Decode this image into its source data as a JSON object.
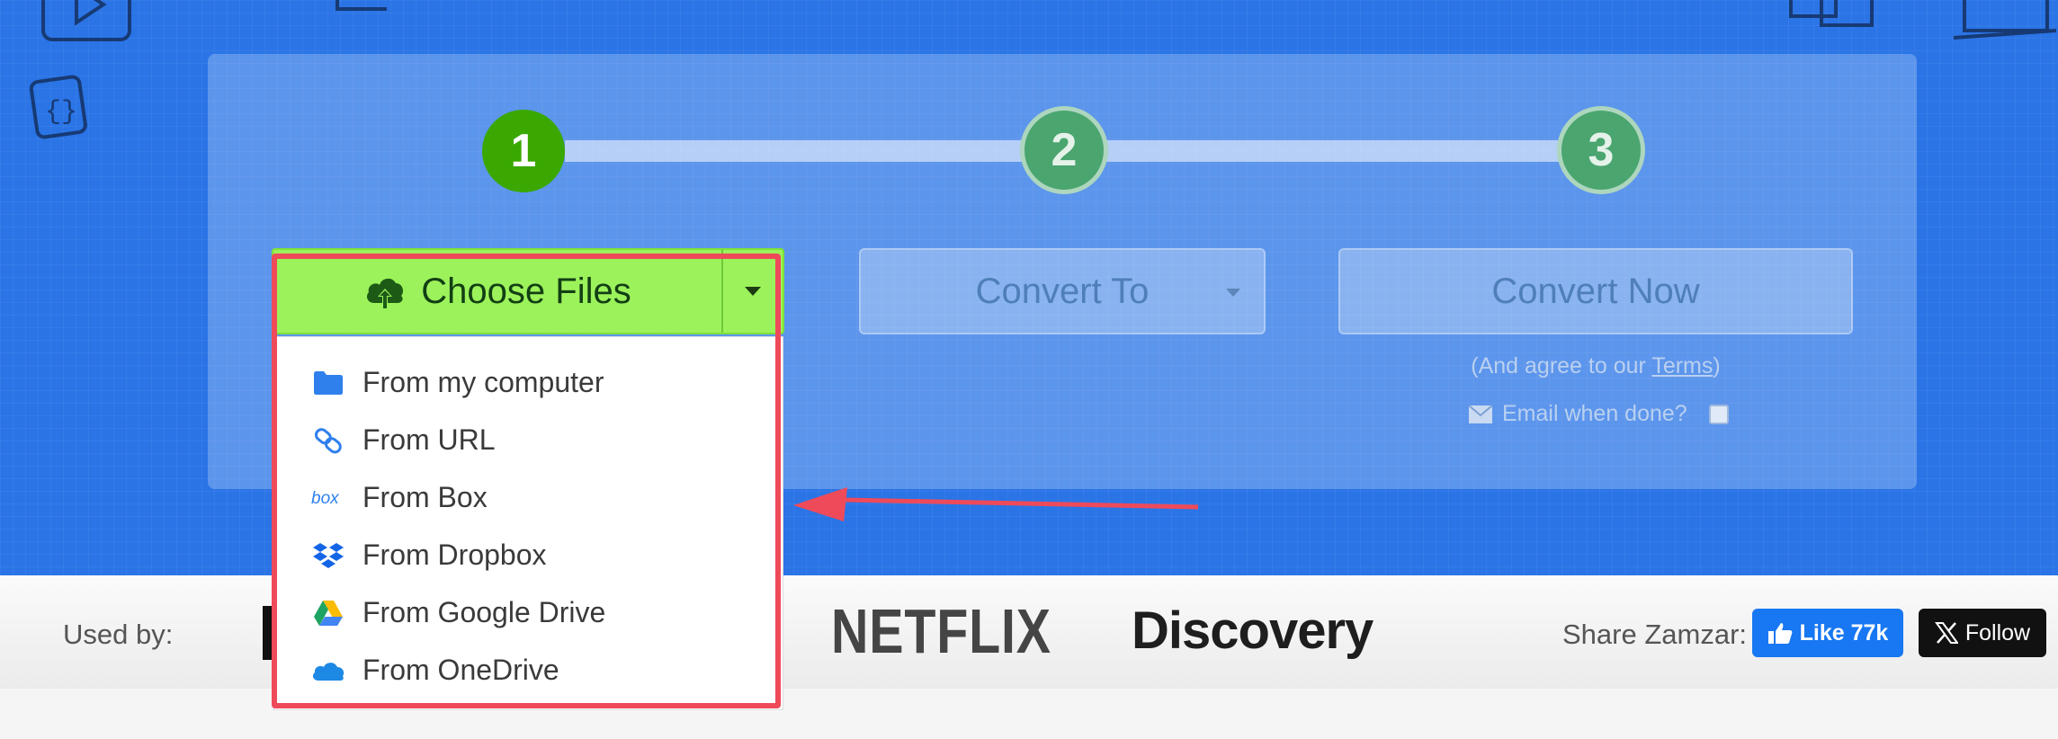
{
  "steps": [
    {
      "number": "1",
      "state": "active"
    },
    {
      "number": "2",
      "state": "pending"
    },
    {
      "number": "3",
      "state": "pending"
    }
  ],
  "choose_files": {
    "label": "Choose Files"
  },
  "convert_to": {
    "label": "Convert To"
  },
  "convert_now": {
    "label": "Convert Now"
  },
  "terms": {
    "prefix": "(And agree to our ",
    "link": "Terms",
    "suffix": ")"
  },
  "email": {
    "label": "Email when done?"
  },
  "dropdown": {
    "items": [
      {
        "label": "From my computer",
        "icon": "folder-icon"
      },
      {
        "label": "From URL",
        "icon": "link-icon"
      },
      {
        "label": "From Box",
        "icon": "box-icon"
      },
      {
        "label": "From Dropbox",
        "icon": "dropbox-icon"
      },
      {
        "label": "From Google Drive",
        "icon": "google-drive-icon"
      },
      {
        "label": "From OneDrive",
        "icon": "onedrive-icon"
      }
    ]
  },
  "used_by": {
    "label": "Used by:",
    "logos": [
      "NETFLIX",
      "Discovery"
    ]
  },
  "share": {
    "label": "Share Zamzar:",
    "like": "Like 77k",
    "follow": "Follow"
  },
  "colors": {
    "hero_blue": "#2a74e6",
    "active_green": "#3aa800",
    "choose_green": "#9cf25b",
    "highlight_red": "#ee4a5a"
  }
}
